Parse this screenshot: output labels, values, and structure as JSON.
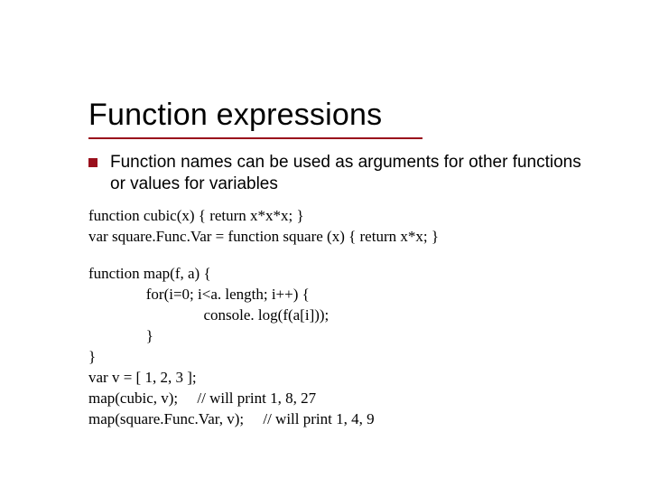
{
  "title": "Function expressions",
  "bullet": "Function names can be used as arguments for other functions or values for variables",
  "code1_l1": "function cubic(x) { return x*x*x; }",
  "code1_l2": "var square.Func.Var = function square (x) { return x*x; }",
  "code2_l1": "function map(f, a) {",
  "code2_l2": "               for(i=0; i<a. length; i++) {",
  "code2_l3": "                              console. log(f(a[i]));",
  "code2_l4": "               }",
  "code2_l5": "}",
  "code2_l6": "var v = [ 1, 2, 3 ];",
  "code2_l7": "map(cubic, v);     // will print 1, 8, 27",
  "code2_l8": "map(square.Func.Var, v);     // will print 1, 4, 9"
}
